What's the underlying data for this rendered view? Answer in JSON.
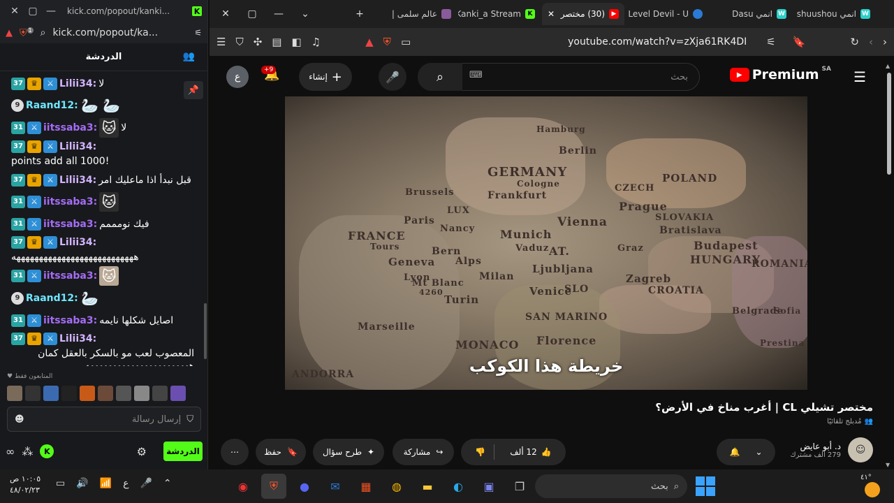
{
  "left": {
    "title_url": "kick.com/popout/kanki...",
    "address_url": "kick.com/popout/ka...",
    "chat_header": "الدردشة",
    "brave_badge": "1",
    "messages": [
      {
        "user": "Lilii34:",
        "user_color": "#d2b4ff",
        "badges": [
          "37",
          "crown",
          "sword"
        ],
        "text": "لا"
      },
      {
        "user": "Raand12:",
        "user_color": "#6ee6ff",
        "badges": [
          "9"
        ],
        "text": "",
        "emotes": [
          "duck",
          "duck"
        ]
      },
      {
        "user": "iitssaba3:",
        "user_color": "#a46cf5",
        "badges": [
          "31",
          "sword"
        ],
        "text": "لا",
        "emotes": [
          "cat"
        ]
      },
      {
        "user": "Lilii34:",
        "user_color": "#d2b4ff",
        "badges": [
          "37",
          "crown",
          "sword"
        ],
        "text": "!points add all 1000"
      },
      {
        "user": "Lilii34:",
        "user_color": "#d2b4ff",
        "badges": [
          "37",
          "crown",
          "sword"
        ],
        "text": "قبل نبدأ اذا ماعليك امر"
      },
      {
        "user": "iitssaba3:",
        "user_color": "#a46cf5",
        "badges": [
          "31",
          "sword"
        ],
        "text": "",
        "emotes": [
          "cat"
        ]
      },
      {
        "user": "iitssaba3:",
        "user_color": "#a46cf5",
        "badges": [
          "31",
          "sword"
        ],
        "text": "فيك نومممم"
      },
      {
        "user": "Lilii34:",
        "user_color": "#d2b4ff",
        "badges": [
          "37",
          "crown",
          "sword"
        ],
        "text": "هههههههههههههههههههههههههههه"
      },
      {
        "user": "iitssaba3:",
        "user_color": "#a46cf5",
        "badges": [
          "31",
          "sword"
        ],
        "text": "",
        "emotes": [
          "cat2"
        ]
      },
      {
        "user": "Raand12:",
        "user_color": "#6ee6ff",
        "badges": [
          "9"
        ],
        "text": "",
        "emotes": [
          "duck"
        ]
      },
      {
        "user": "iitssaba3:",
        "user_color": "#a46cf5",
        "badges": [
          "31",
          "sword"
        ],
        "text": "اصايل شكلها نايمه"
      },
      {
        "user": "Lilii34:",
        "user_color": "#d2b4ff",
        "badges": [
          "37",
          "crown",
          "sword"
        ],
        "text": "المعصوب لعب مو بالسكر بالعقل كمان هههههههههههههههههههههههه"
      }
    ],
    "viewers_label": "المتابعون فقط",
    "input_placeholder": "إرسال رسالة",
    "send_label": "الدردشة"
  },
  "main": {
    "tabs": [
      {
        "label": "عالم سلمى |",
        "favicon": "avatar",
        "active": false
      },
      {
        "label": "Kanki_a Stream",
        "favicon": "kick",
        "active": false
      },
      {
        "label": "(30) مختصر",
        "favicon": "youtube",
        "active": true
      },
      {
        "label": "Level Devil - U",
        "favicon": "globe",
        "active": false
      },
      {
        "label": "انمي Dasu",
        "favicon": "w",
        "active": false
      },
      {
        "label": "انمي shuushou",
        "favicon": "w",
        "active": false
      }
    ],
    "address_url": "youtube.com/watch?v=zXja61RK4DI",
    "yt": {
      "brand": "Premium",
      "region": "SA",
      "search_placeholder": "بحث",
      "create_label": "إنشاء",
      "notif_count": "+9",
      "avatar_letter": "ع"
    },
    "map_labels": [
      "GERMANY",
      "FRANCE",
      "POLAND",
      "CZECH",
      "SLOVAKIA",
      "HUNGARY",
      "ROMANIA",
      "CROATIA",
      "Berlin",
      "Prague",
      "Vienna",
      "Paris",
      "Munich",
      "Budapest",
      "Bratislava",
      "Brussels",
      "Frankfurt",
      "Cologne",
      "Geneva",
      "Tours",
      "Zagreb",
      "Marseille",
      "MONACO",
      "Florence",
      "ANDORRA",
      "SAN MARINO",
      "Venice",
      "Milan",
      "Turin",
      "Bern",
      "Vaduz",
      "Ljubljana",
      "Nancy",
      "LUX",
      "AT.",
      "SLO",
      "Belgrade",
      "Graz",
      "Alps",
      "Mt Blanc",
      "4260",
      "Sofia",
      "Prestina",
      "Hamburg",
      "Lyon"
    ],
    "subtitle": "خريطة هذا الكوكب",
    "video_title": "مختصر تشيلي CL | أغرب مناخ في الأرض؟",
    "video_sub": "مُدبلج تلقائيًا",
    "channel_name": "د. أبو عايض",
    "channel_subs": "279 ألف مشترك",
    "likes": "12 ألف",
    "share_label": "مشاركة",
    "ask_label": "طرح سؤال",
    "save_label": "حفظ"
  },
  "taskbar": {
    "time": "١٠:٠٥ ص",
    "date": "٤٨/٠٢/٢٣",
    "lang": "ع",
    "search_label": "بحث",
    "weather": "٤١°"
  }
}
